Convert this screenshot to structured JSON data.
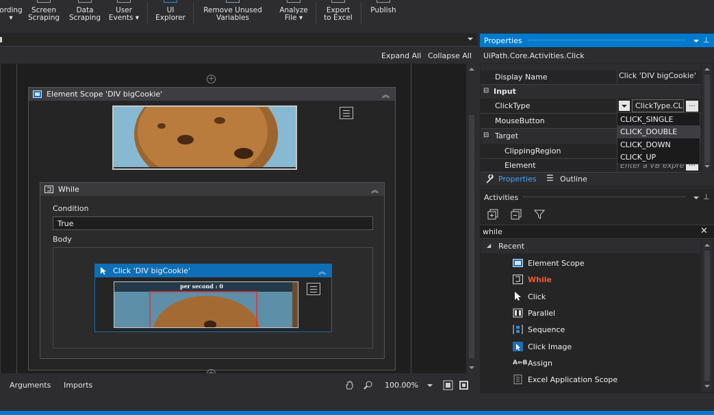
{
  "ribbon": {
    "buttons": [
      {
        "label": "ording\n▾"
      },
      {
        "label": "Screen\nScraping"
      },
      {
        "label": "Data\nScraping"
      },
      {
        "label": "User\nEvents ▾"
      },
      {
        "label": "UI\nExplorer"
      },
      {
        "label": "Remove Unused\nVariables"
      },
      {
        "label": "Analyze\nFile ▾"
      },
      {
        "label": "Export\nto Excel"
      },
      {
        "label": "Publish"
      }
    ]
  },
  "designer": {
    "expand_all": "Expand All",
    "collapse_all": "Collapse All",
    "element_scope_title": "Element Scope 'DIV  bigCookie'",
    "while_title": "While",
    "condition_label": "Condition",
    "condition_value": "True",
    "body_label": "Body",
    "click_title": "Click 'DIV  bigCookie'",
    "cookie_caption": "per second : 0",
    "collapse_glyph": "︽"
  },
  "bottom": {
    "arguments": "Arguments",
    "imports": "Imports",
    "zoom": "100.00%"
  },
  "properties": {
    "title": "Properties",
    "class_name": "UiPath.Core.Activities.Click",
    "display_name_label": "Display Name",
    "display_name_value": "Click 'DIV  bigCookie'",
    "input_label": "Input",
    "clicktype_label": "ClickType",
    "clicktype_value": "ClickType.CL",
    "mousebutton_label": "MouseButton",
    "target_label": "Target",
    "clipping_label": "ClippingRegion",
    "element_label": "Element",
    "element_placeholder": "Enter a VB expre",
    "ellipsis": "...",
    "dropdown_options": [
      "CLICK_SINGLE",
      "CLICK_DOUBLE",
      "CLICK_DOWN",
      "CLICK_UP"
    ],
    "dropdown_selected": "CLICK_DOUBLE",
    "tab_properties": "Properties",
    "tab_outline": "Outline"
  },
  "activities": {
    "title": "Activities",
    "search_value": "while",
    "recent_label": "Recent",
    "items": [
      {
        "label": "Element Scope",
        "icon": "element-scope-icon",
        "highlight": false
      },
      {
        "label": "While",
        "icon": "while-icon",
        "highlight": true
      },
      {
        "label": "Click",
        "icon": "cursor-icon",
        "highlight": false
      },
      {
        "label": "Parallel",
        "icon": "parallel-icon",
        "highlight": false
      },
      {
        "label": "Sequence",
        "icon": "sequence-icon",
        "highlight": false
      },
      {
        "label": "Click Image",
        "icon": "click-image-icon",
        "highlight": false
      },
      {
        "label": "Assign",
        "icon": "assign-icon",
        "highlight": false
      },
      {
        "label": "Excel Application Scope",
        "icon": "excel-scope-icon",
        "highlight": false
      }
    ]
  },
  "colors": {
    "accent": "#007acc",
    "header_blue": "#0e6fb6",
    "highlight_red": "#f05a3c"
  }
}
